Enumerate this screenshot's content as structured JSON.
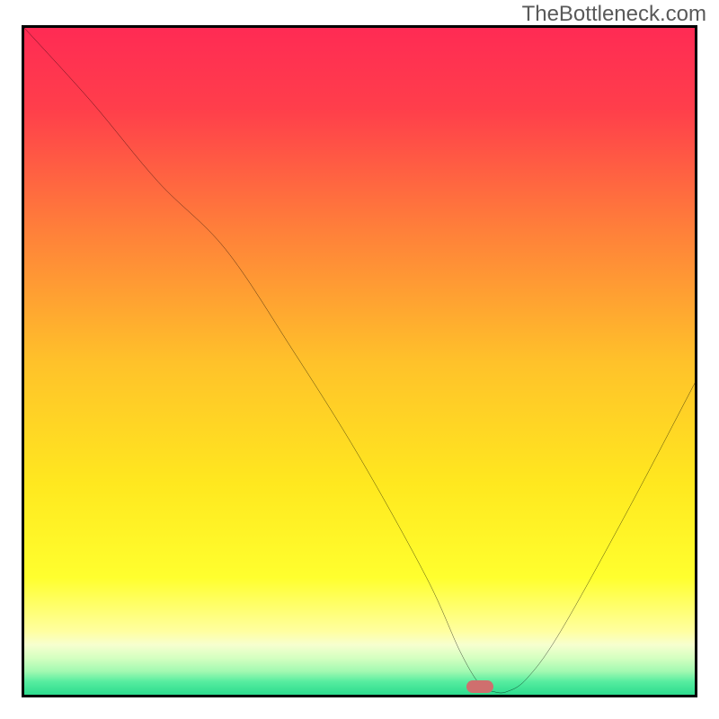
{
  "watermark": "TheBottleneck.com",
  "chart_data": {
    "type": "line",
    "title": "",
    "xlabel": "",
    "ylabel": "",
    "xlim": [
      0,
      100
    ],
    "ylim": [
      0,
      100
    ],
    "x": [
      0,
      10,
      20,
      30,
      40,
      50,
      60,
      65,
      68,
      70,
      72,
      75,
      80,
      90,
      100
    ],
    "values": [
      100,
      89,
      77,
      67,
      52,
      36,
      18,
      7,
      2,
      1,
      1,
      3,
      10,
      28,
      47
    ],
    "marker": {
      "x": 68,
      "y": 1
    },
    "gradient_stops": [
      {
        "pos": 0.0,
        "color": "#ff2b54"
      },
      {
        "pos": 0.12,
        "color": "#ff3e4b"
      },
      {
        "pos": 0.3,
        "color": "#ff7f3a"
      },
      {
        "pos": 0.5,
        "color": "#ffc22a"
      },
      {
        "pos": 0.68,
        "color": "#ffe81f"
      },
      {
        "pos": 0.82,
        "color": "#ffff2e"
      },
      {
        "pos": 0.9,
        "color": "#ffffa0"
      },
      {
        "pos": 0.92,
        "color": "#f7ffcf"
      },
      {
        "pos": 0.94,
        "color": "#d4ffc0"
      },
      {
        "pos": 0.96,
        "color": "#a1f9b1"
      },
      {
        "pos": 0.975,
        "color": "#57eda0"
      },
      {
        "pos": 1.0,
        "color": "#21d789"
      }
    ]
  }
}
